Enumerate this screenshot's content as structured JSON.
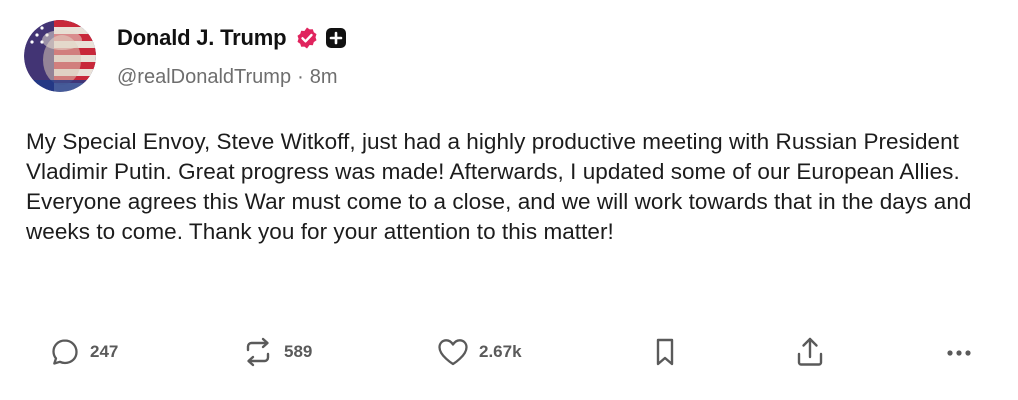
{
  "post": {
    "display_name": "Donald J. Trump",
    "handle": "@realDonaldTrump",
    "separator": "·",
    "time_ago": "8m",
    "text": "My Special Envoy, Steve Witkoff, just had a highly productive meeting with Russian President Vladimir Putin. Great progress was made! Afterwards, I updated some of our European Allies. Everyone agrees this War must come to a close, and we will work towards that in the days and weeks to come. Thank you for your attention to this matter!",
    "verified_color": "#e0245e",
    "badge_color": "#111111"
  },
  "actions": {
    "replies": {
      "icon": "comment-icon",
      "count": "247"
    },
    "retruths": {
      "icon": "repost-icon",
      "count": "589"
    },
    "likes": {
      "icon": "heart-icon",
      "count": "2.67k"
    },
    "bookmark": {
      "icon": "bookmark-icon"
    },
    "share": {
      "icon": "share-icon"
    },
    "more": {
      "icon": "more-icon"
    }
  }
}
